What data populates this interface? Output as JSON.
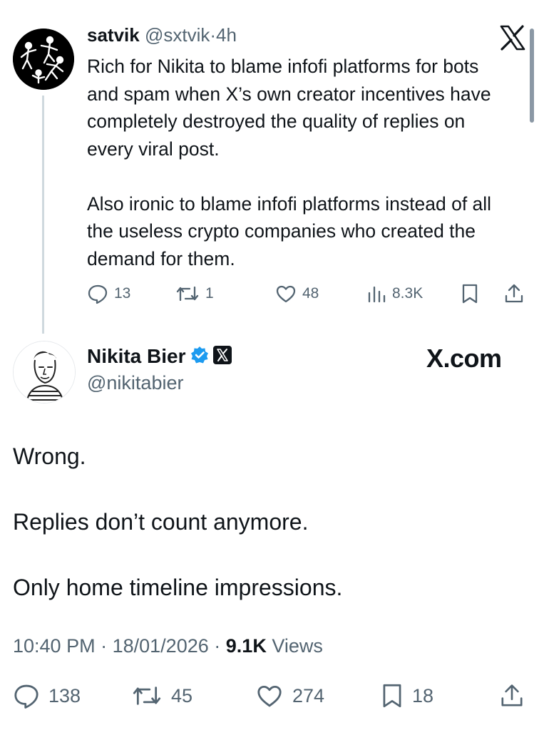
{
  "parent_tweet": {
    "author_name": "satvik",
    "handle": "@sxtvik",
    "separator": "·",
    "time": "4h",
    "paragraphs": [
      "Rich for Nikita to blame infofi platforms for bots and spam when X’s own creator incentives have completely destroyed the quality of replies on every viral post.",
      "Also ironic to blame infofi platforms instead of all the useless crypto companies who created the demand for them."
    ],
    "stats": {
      "replies": "13",
      "reposts": "1",
      "likes": "48",
      "views": "8.3K"
    },
    "icons": [
      "reply-icon",
      "repost-icon",
      "like-icon",
      "views-icon",
      "bookmark-icon",
      "share-icon"
    ]
  },
  "main_tweet": {
    "author_name": "Nikita Bier",
    "handle": "@nikitabier",
    "watermark": "X.com",
    "paragraphs": [
      "Wrong.",
      "Replies don’t count anymore.",
      "Only home timeline impressions."
    ],
    "meta": {
      "time": "10:40 PM",
      "date": "18/01/2026",
      "views_count": "9.1K",
      "views_label": "Views",
      "separator": "·"
    },
    "stats": {
      "replies": "138",
      "reposts": "45",
      "likes": "274",
      "bookmarks": "18"
    },
    "badges": [
      "verified-badge-icon",
      "x-affiliate-badge-icon"
    ]
  },
  "colors": {
    "text_primary": "#0f1419",
    "text_secondary": "#536471",
    "verified_blue": "#1d9bf0",
    "thread_line": "#cfd9de",
    "background": "#ffffff"
  }
}
